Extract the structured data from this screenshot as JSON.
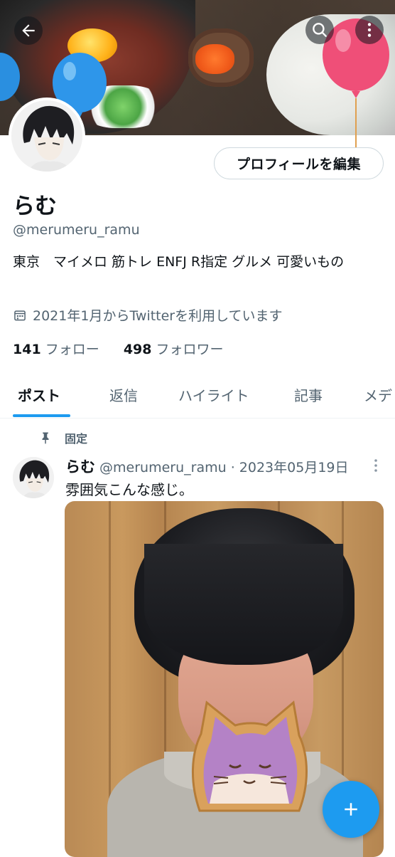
{
  "profile": {
    "display_name": "らむ",
    "handle": "@merumeru_ramu",
    "bio": "東京　マイメロ 筋トレ ENFJ R指定 グルメ 可愛いもの",
    "joined": "2021年1月からTwitterを利用しています",
    "following_count": "141",
    "following_label": "フォロー",
    "followers_count": "498",
    "followers_label": "フォロワー",
    "edit_button_label": "プロフィールを編集"
  },
  "tabs": [
    {
      "label": "ポスト",
      "active": true
    },
    {
      "label": "返信",
      "active": false
    },
    {
      "label": "ハイライト",
      "active": false
    },
    {
      "label": "記事",
      "active": false
    },
    {
      "label": "メデ",
      "active": false
    }
  ],
  "pinned_post": {
    "pinned_label": "固定",
    "author_name": "らむ",
    "author_handle": "@merumeru_ramu",
    "separator": "·",
    "date": "2023年05月19日",
    "text": "雰囲気こんな感じ。"
  },
  "icons": {
    "back": "back-arrow-icon",
    "search": "search-icon",
    "more": "more-vertical-icon",
    "calendar": "calendar-icon",
    "pin": "pin-icon",
    "compose": "plus-icon"
  },
  "colors": {
    "accent": "#1d9bf0",
    "text_primary": "#0f1419",
    "text_secondary": "#536471",
    "border": "#cfd9de"
  }
}
